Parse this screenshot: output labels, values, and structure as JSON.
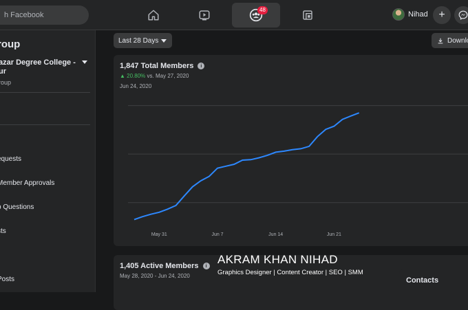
{
  "topbar": {
    "search_placeholder": "h Facebook",
    "groups_badge": "48",
    "user_name": "Nihad",
    "add_label": "+"
  },
  "sidebar": {
    "title": "roup",
    "group_name": "azar Degree College - ur",
    "group_sub": "roup",
    "items": [
      {
        "label": "equests"
      },
      {
        "label": "Member Approvals"
      },
      {
        "label": "p Questions"
      },
      {
        "label": "sts"
      },
      {
        "label": "Posts"
      }
    ]
  },
  "main": {
    "date_range": "Last 28 Days",
    "download_label": "Downlo"
  },
  "total_members": {
    "title": "1,847 Total Members",
    "change_pct": "20.80%",
    "change_suffix": "vs. May 27, 2020",
    "date": "Jun 24, 2020"
  },
  "active_members": {
    "title": "1,405 Active Members",
    "date_range": "May 28, 2020 - Jun 24, 2020"
  },
  "overlay": {
    "name": "AKRAM KHAN NIHAD",
    "role": "Graphics Designer | Content Creator | SEO | SMM"
  },
  "contacts": {
    "label": "Contacts"
  },
  "colors": {
    "line": "#2d88ff",
    "positive": "#45bd62",
    "badge": "#e41e3f"
  },
  "chart_data": {
    "type": "line",
    "title": "1,847 Total Members",
    "x_tick_labels": [
      "May 31",
      "Jun 7",
      "Jun 14",
      "Jun 21"
    ],
    "x": [
      "May 28",
      "May 29",
      "May 30",
      "May 31",
      "Jun 1",
      "Jun 2",
      "Jun 3",
      "Jun 4",
      "Jun 5",
      "Jun 6",
      "Jun 7",
      "Jun 8",
      "Jun 9",
      "Jun 10",
      "Jun 11",
      "Jun 12",
      "Jun 13",
      "Jun 14",
      "Jun 15",
      "Jun 16",
      "Jun 17",
      "Jun 18",
      "Jun 19",
      "Jun 20",
      "Jun 21",
      "Jun 22",
      "Jun 23",
      "Jun 24"
    ],
    "values": [
      1530,
      1542,
      1552,
      1560,
      1573,
      1588,
      1627,
      1665,
      1690,
      1708,
      1742,
      1750,
      1758,
      1775,
      1777,
      1785,
      1795,
      1808,
      1812,
      1818,
      1822,
      1832,
      1872,
      1902,
      1915,
      1943,
      1957,
      1970
    ],
    "ylim": [
      1500,
      2050
    ],
    "grid": true
  }
}
